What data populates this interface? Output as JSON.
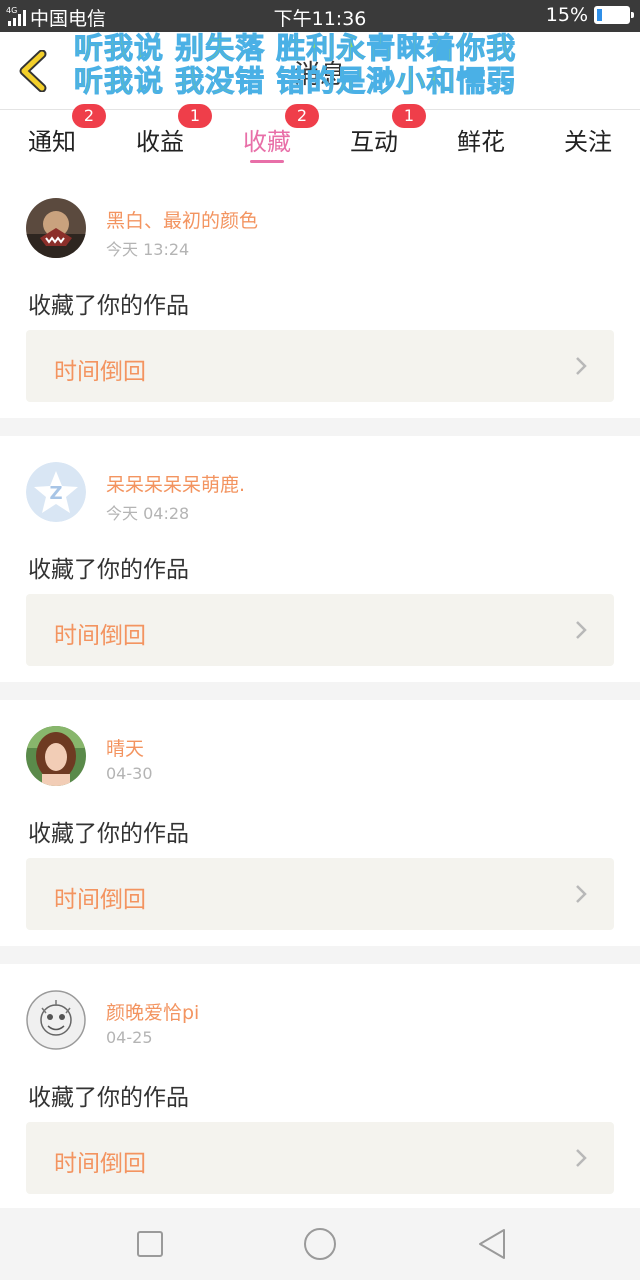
{
  "status_bar": {
    "network": "4G",
    "carrier": "中国电信",
    "time": "下午11:36",
    "battery": "15%",
    "battery_level": 0.15
  },
  "header": {
    "title": "消息",
    "overlay_line1": "听我说 别失落 胜利永青睐着你我",
    "overlay_line2": "听我说 我没错 错的是渺小和懦弱"
  },
  "tabs": [
    {
      "label": "通知",
      "badge": "2"
    },
    {
      "label": "收益",
      "badge": "1"
    },
    {
      "label": "收藏",
      "badge": "2",
      "active": true
    },
    {
      "label": "互动",
      "badge": "1"
    },
    {
      "label": "鲜花",
      "badge": ""
    },
    {
      "label": "关注",
      "badge": ""
    }
  ],
  "items": [
    {
      "user": "黑白、最初的颜色",
      "time": "今天 13:24",
      "action": "收藏了你的作品",
      "work": "时间倒回",
      "avatar": "dark-photo"
    },
    {
      "user": "呆呆呆呆呆萌鹿.",
      "time": "今天 04:28",
      "action": "收藏了你的作品",
      "work": "时间倒回",
      "avatar": "default-z"
    },
    {
      "user": "晴天",
      "time": "04-30",
      "action": "收藏了你的作品",
      "work": "时间倒回",
      "avatar": "portrait"
    },
    {
      "user": "颜晚爱恰pi",
      "time": "04-25",
      "action": "收藏了你的作品",
      "work": "时间倒回",
      "avatar": "sketch"
    }
  ],
  "colors": {
    "accent_pink": "#e86fa8",
    "name_orange": "#f39460",
    "badge_red": "#ef3e4a",
    "back_yellow": "#f3cf2a"
  }
}
